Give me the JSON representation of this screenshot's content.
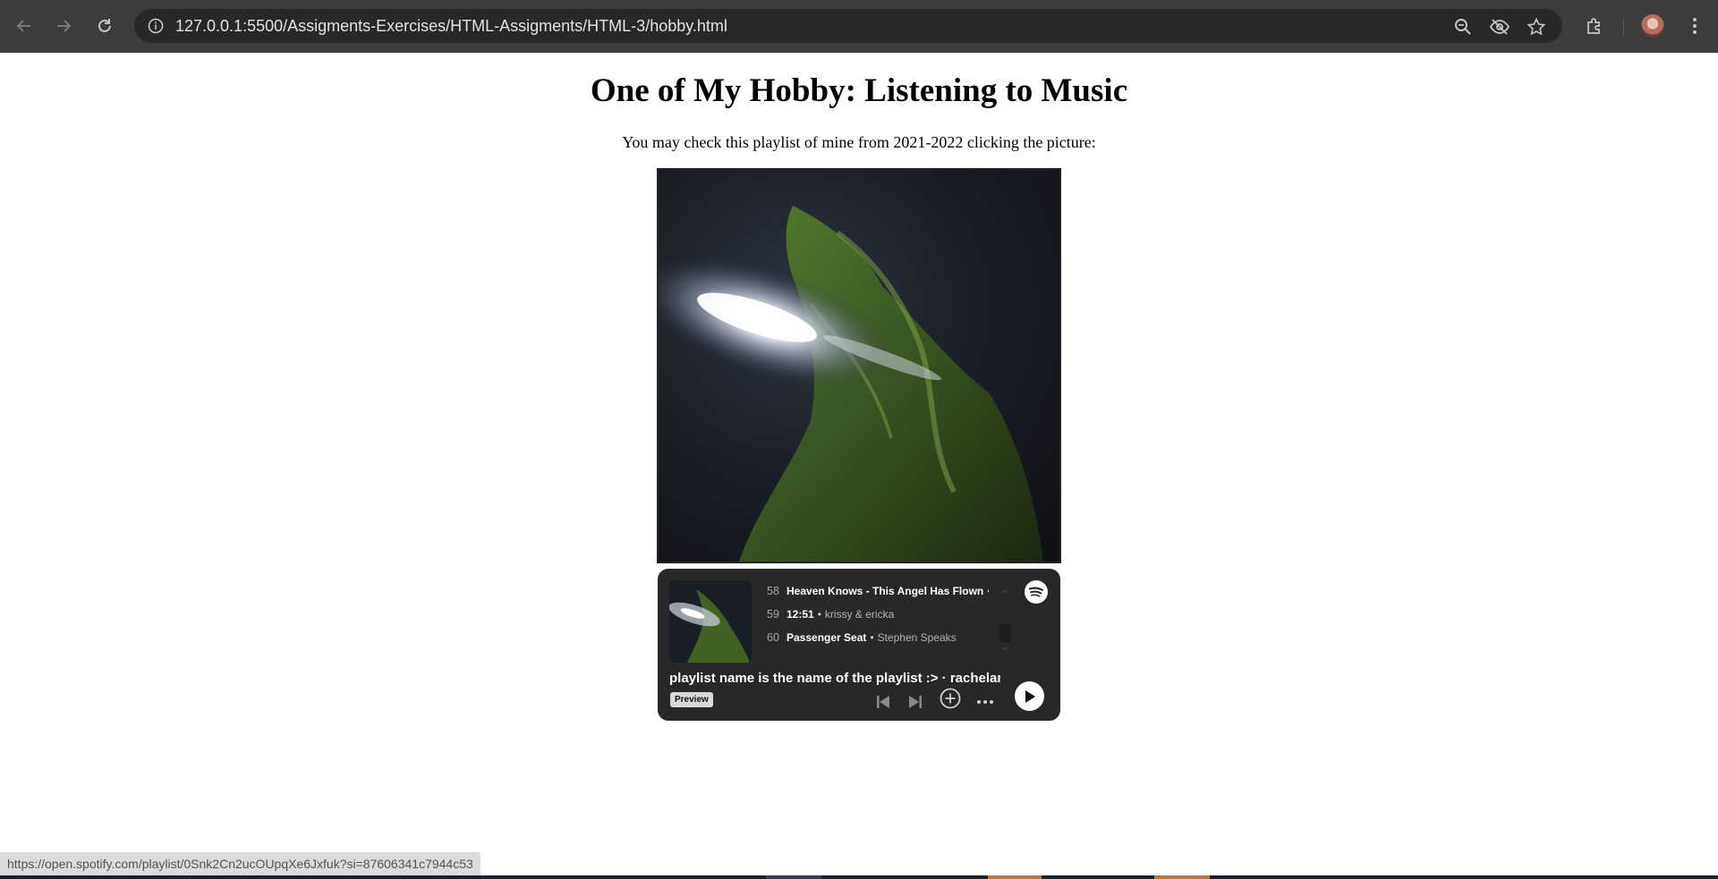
{
  "browser": {
    "url": "127.0.0.1:5500/Assigments-Exercises/HTML-Assigments/HTML-3/hobby.html",
    "icons": {
      "back": "arrow-left-icon",
      "forward": "arrow-right-icon",
      "reload": "reload-icon",
      "site_info": "info-icon",
      "zoom": "zoom-icon",
      "eye_off": "eye-off-icon",
      "bookmark": "star-icon",
      "extensions": "puzzle-icon",
      "menu": "kebab-menu-icon"
    }
  },
  "page": {
    "title": "One of My Hobby: Listening to Music",
    "subtitle": "You may check this playlist of mine from 2021-2022 clicking the picture:"
  },
  "spotify_embed": {
    "tracks": [
      {
        "number": "58",
        "title": "Heaven Knows - This Angel Has Flown",
        "artist": "…"
      },
      {
        "number": "59",
        "title": "12:51",
        "artist": "krissy & ericka"
      },
      {
        "number": "60",
        "title": "Passenger Seat",
        "artist": "Stephen Speaks"
      }
    ],
    "playlist_name": "playlist name is the name of the playlist :> · rachelann",
    "preview_label": "Preview",
    "colors": {
      "background": "#282828",
      "accent": "#ffffff"
    }
  },
  "status_bar": {
    "link_url": "https://open.spotify.com/playlist/0Snk2Cn2ucOUpqXe6Jxfuk?si=87606341c7944c53"
  }
}
